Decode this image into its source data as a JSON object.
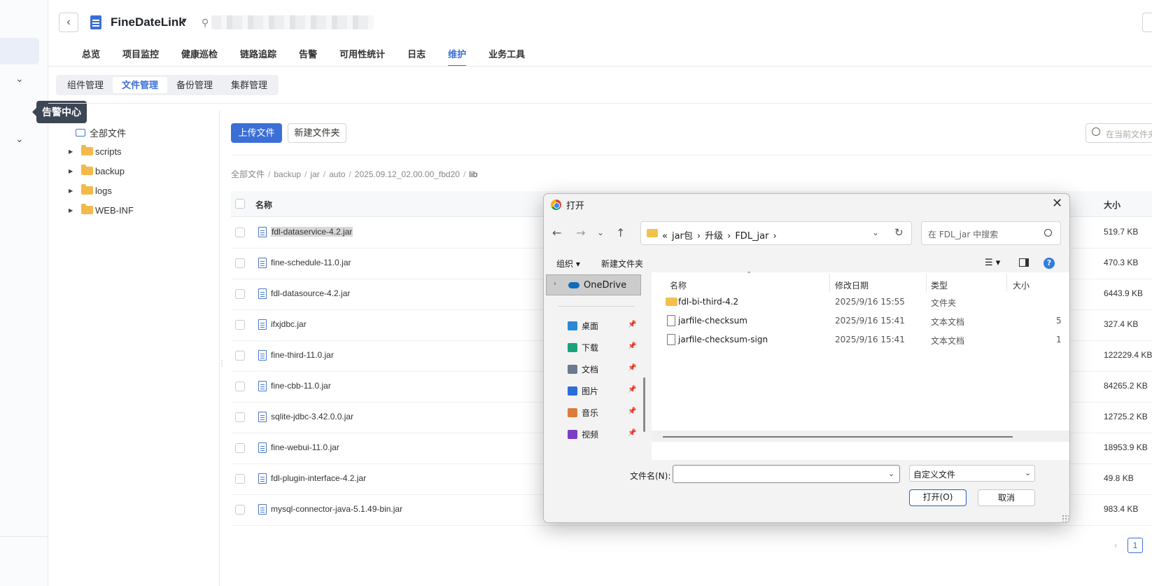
{
  "app": {
    "title": "FineDateLink",
    "tooltip": "告警中心"
  },
  "nav": {
    "tabs": [
      "总览",
      "项目监控",
      "健康巡检",
      "链路追踪",
      "告警",
      "可用性统计",
      "日志",
      "维护",
      "业务工具"
    ],
    "active": "维护"
  },
  "subtabs": {
    "items": [
      "组件管理",
      "文件管理",
      "备份管理",
      "集群管理"
    ],
    "active": "文件管理"
  },
  "tree": {
    "root": "全部文件",
    "folders": [
      "scripts",
      "backup",
      "logs",
      "WEB-INF"
    ]
  },
  "toolbar": {
    "upload": "上传文件",
    "new_folder": "新建文件夹",
    "search_placeholder": "在当前文件夹"
  },
  "breadcrumb": [
    "全部文件",
    "backup",
    "jar",
    "auto",
    "2025.09.12_02.00.00_fbd20",
    "lib"
  ],
  "table": {
    "col_name": "名称",
    "col_size": "大小",
    "rows": [
      {
        "name": "fdl-dataservice-4.2.jar",
        "size": "519.7 KB"
      },
      {
        "name": "fine-schedule-11.0.jar",
        "size": "470.3 KB"
      },
      {
        "name": "fdl-datasource-4.2.jar",
        "size": "6443.9 KB"
      },
      {
        "name": "ifxjdbc.jar",
        "size": "327.4 KB"
      },
      {
        "name": "fine-third-11.0.jar",
        "size": "122229.4 KB"
      },
      {
        "name": "fine-cbb-11.0.jar",
        "size": "84265.2 KB"
      },
      {
        "name": "sqlite-jdbc-3.42.0.0.jar",
        "size": "12725.2 KB"
      },
      {
        "name": "fine-webui-11.0.jar",
        "size": "18953.9 KB"
      },
      {
        "name": "fdl-plugin-interface-4.2.jar",
        "size": "49.8 KB"
      },
      {
        "name": "mysql-connector-java-5.1.49-bin.jar",
        "size": "983.4 KB"
      }
    ]
  },
  "pagination": {
    "current": "1"
  },
  "dialog": {
    "title": "打开",
    "path": [
      "«",
      "jar包",
      "›",
      "升级",
      "›",
      "FDL_jar",
      "›"
    ],
    "search_placeholder": "在 FDL_jar 中搜索",
    "organize": "组织 ▾",
    "new_folder": "新建文件夹",
    "onedrive": "OneDrive",
    "quick_access": [
      {
        "label": "桌面",
        "color": "#2b88d8"
      },
      {
        "label": "下载",
        "color": "#1aa37a"
      },
      {
        "label": "文档",
        "color": "#6b7a8f"
      },
      {
        "label": "图片",
        "color": "#2b6fd6"
      },
      {
        "label": "音乐",
        "color": "#e07a3c"
      },
      {
        "label": "视频",
        "color": "#7b3fc4"
      }
    ],
    "columns": {
      "name": "名称",
      "modified": "修改日期",
      "type": "类型",
      "size": "大小"
    },
    "files": [
      {
        "name": "fdl-bi-third-4.2",
        "modified": "2025/9/16 15:55",
        "type": "文件夹",
        "size": "",
        "kind": "folder"
      },
      {
        "name": "jarfile-checksum",
        "modified": "2025/9/16 15:41",
        "type": "文本文档",
        "size": "5",
        "kind": "doc"
      },
      {
        "name": "jarfile-checksum-sign",
        "modified": "2025/9/16 15:41",
        "type": "文本文档",
        "size": "1",
        "kind": "doc"
      }
    ],
    "filename_label": "文件名(N):",
    "filename_value": "",
    "filter": "自定义文件",
    "open": "打开(O)",
    "cancel": "取消"
  }
}
